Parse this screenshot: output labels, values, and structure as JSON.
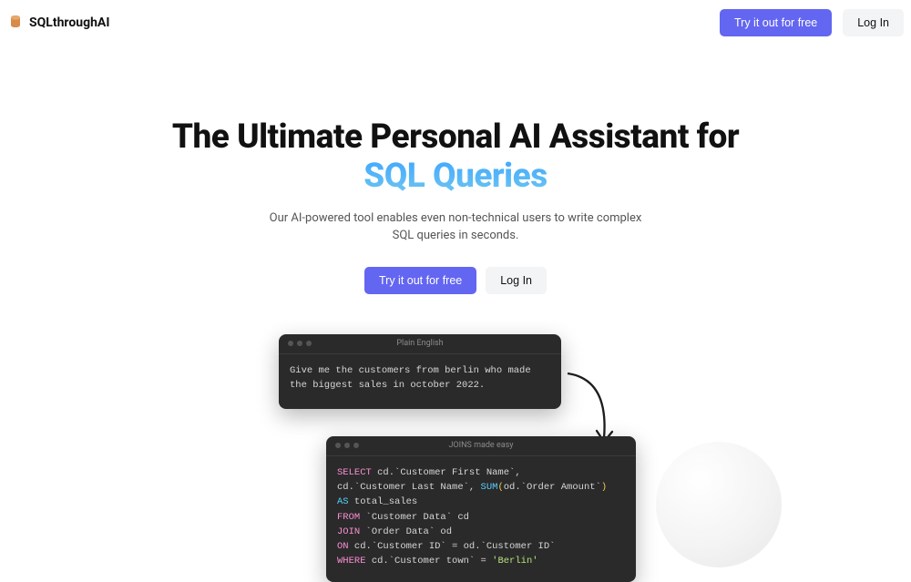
{
  "header": {
    "brand": "SQLthroughAI",
    "try_button": "Try it out for free",
    "login_button": "Log In"
  },
  "hero": {
    "title_prefix": "The Ultimate Personal AI Assistant for ",
    "title_highlight": "SQL Queries",
    "subtitle": "Our AI-powered tool enables even non-technical users to write complex SQL queries in seconds.",
    "try_button": "Try it out for free",
    "login_button": "Log In"
  },
  "demo": {
    "input_card": {
      "title": "Plain English",
      "text": "Give me the customers from berlin who made the biggest sales in october 2022."
    },
    "output_card": {
      "title": "JOINS made easy",
      "lines": [
        {
          "kw": "SELECT",
          "rest": " cd.`Customer First Name`,"
        },
        {
          "plain": "cd.`Customer Last Name`, ",
          "func": "SUM",
          "paren_open": "(",
          "arg": "od.`Order Amount`",
          "paren_close": ")"
        },
        {
          "as": "AS",
          "rest": " total_sales"
        },
        {
          "kw": "FROM",
          "rest": " `Customer Data` cd"
        },
        {
          "kw": "JOIN",
          "rest": " `Order Data` od"
        },
        {
          "kw": "ON",
          "rest": " cd.`Customer ID` = od.`Customer ID`"
        },
        {
          "kw": "WHERE",
          "rest": " cd.`Customer town` = ",
          "str": "'Berlin'"
        }
      ]
    }
  }
}
